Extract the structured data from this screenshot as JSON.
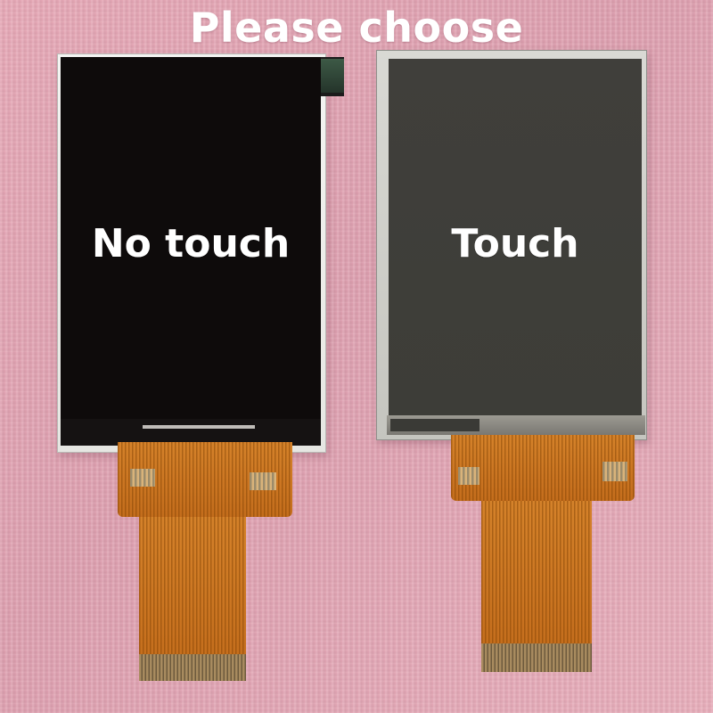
{
  "title": "Please choose",
  "options": [
    {
      "label": "No touch"
    },
    {
      "label": "Touch"
    }
  ],
  "colors": {
    "background": "#e2a5b4",
    "no_touch_screen": "#0e0b0b",
    "touch_screen": "#3f3e3a",
    "flex_cable": "#cf7a24",
    "label_text": "#ffffff"
  }
}
